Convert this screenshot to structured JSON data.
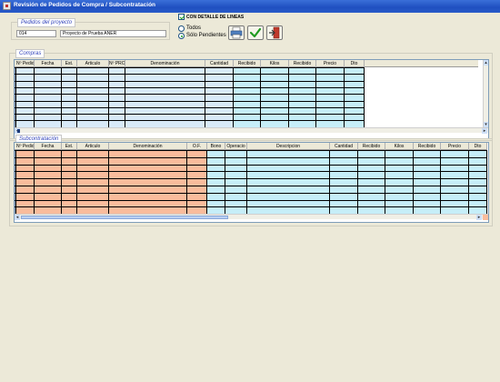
{
  "window": {
    "title": "Revisión de Pedidos de Compra / Subcontratación"
  },
  "proyecto": {
    "group_title": "Pedidos del proyecto",
    "code": "014",
    "name": "Proyecto de Prueba ANER"
  },
  "options": {
    "detail_checkbox_label": "CON DETALLE DE LINEAS",
    "detail_checked": true,
    "radio_todos": "Todos",
    "radio_pendientes": "Sólo Pendientes",
    "selected": "Sólo Pendientes"
  },
  "toolbar": {
    "print_icon": "printer-icon",
    "accept_icon": "checkmark-icon",
    "exit_icon": "exit-door-icon"
  },
  "compras": {
    "group_title": "Compras",
    "columns": [
      "Nº Pedid",
      "Fecha",
      "Est.",
      "Articulo",
      "Nº PROC",
      "Denominación",
      "Cantidad",
      "Recibido",
      "Kilos",
      "Recibido",
      "Precio",
      "Dto"
    ]
  },
  "subcontratacion": {
    "group_title": "Subcontratación",
    "columns": [
      "Nº Pedid",
      "Fecha",
      "Est.",
      "Articulo",
      "Denominación",
      "O.F.",
      "Bono",
      "Operacio",
      "Descripcion",
      "Cantidad",
      "Recibido",
      "Kilos",
      "Recibido",
      "Precio",
      "Dto"
    ]
  },
  "colors": {
    "light_blue": "#D8EAF8",
    "cyan": "#C6EEF8",
    "salmon": "#F9BC9C"
  }
}
